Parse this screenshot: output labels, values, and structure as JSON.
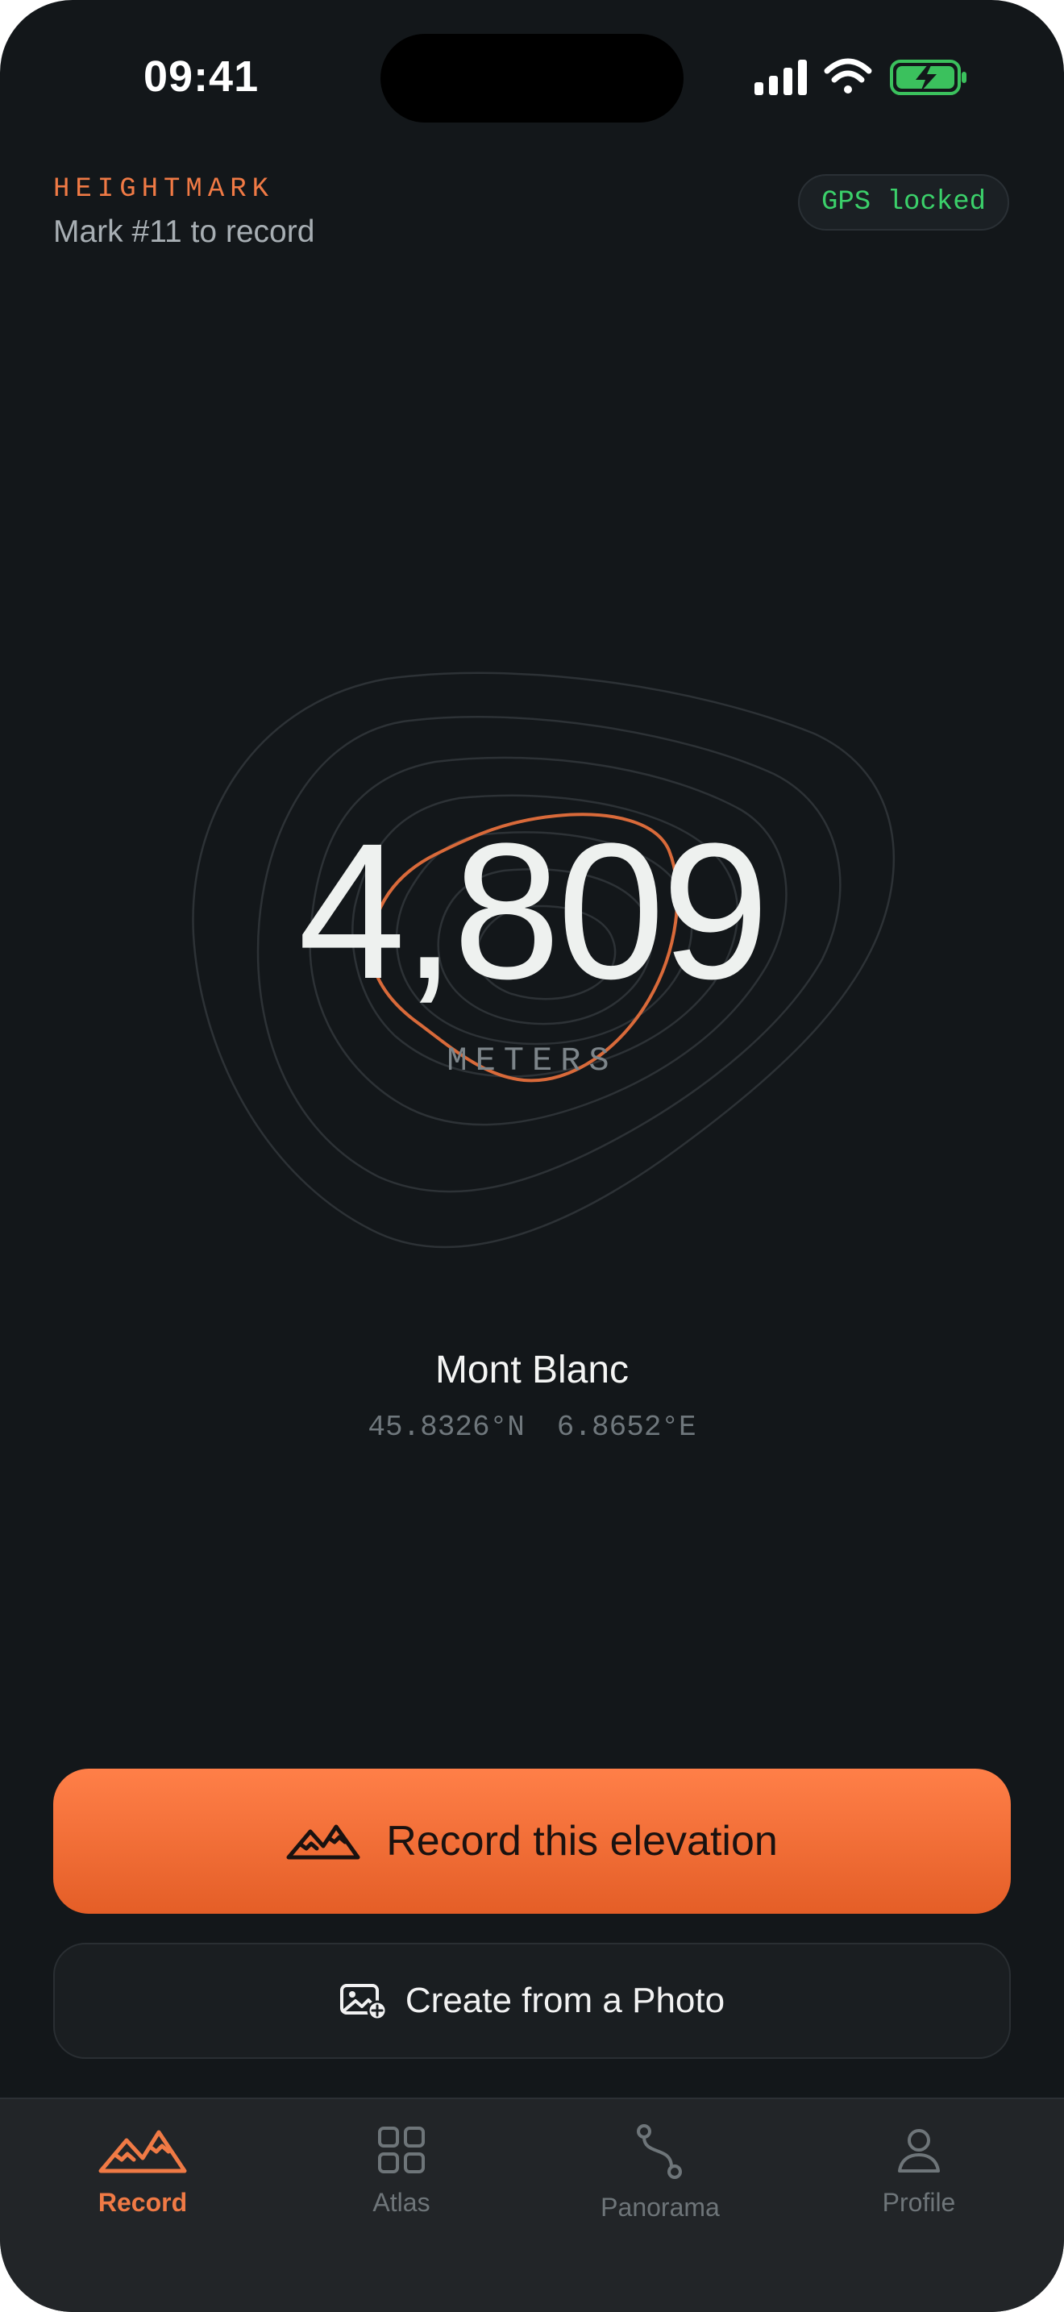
{
  "status_bar": {
    "time": "09:41"
  },
  "header": {
    "brand": "HEIGHTMARK",
    "subtitle": "Mark #11 to record",
    "gps_badge": "GPS locked"
  },
  "reading": {
    "elevation": "4,809",
    "unit": "METERS",
    "place": "Mont Blanc",
    "latitude": "45.8326°N",
    "longitude": "6.8652°E"
  },
  "actions": {
    "record_label": "Record this elevation",
    "photo_label": "Create from a Photo"
  },
  "tabs": [
    {
      "label": "Record",
      "icon": "mountains-icon",
      "active": true
    },
    {
      "label": "Atlas",
      "icon": "grid-icon",
      "active": false
    },
    {
      "label": "Panorama",
      "icon": "route-icon",
      "active": false
    },
    {
      "label": "Profile",
      "icon": "person-icon",
      "active": false
    }
  ],
  "colors": {
    "accent": "#f07a45",
    "background": "#13171a",
    "gps_ok": "#3bd06a",
    "tabbar": "#222528"
  }
}
